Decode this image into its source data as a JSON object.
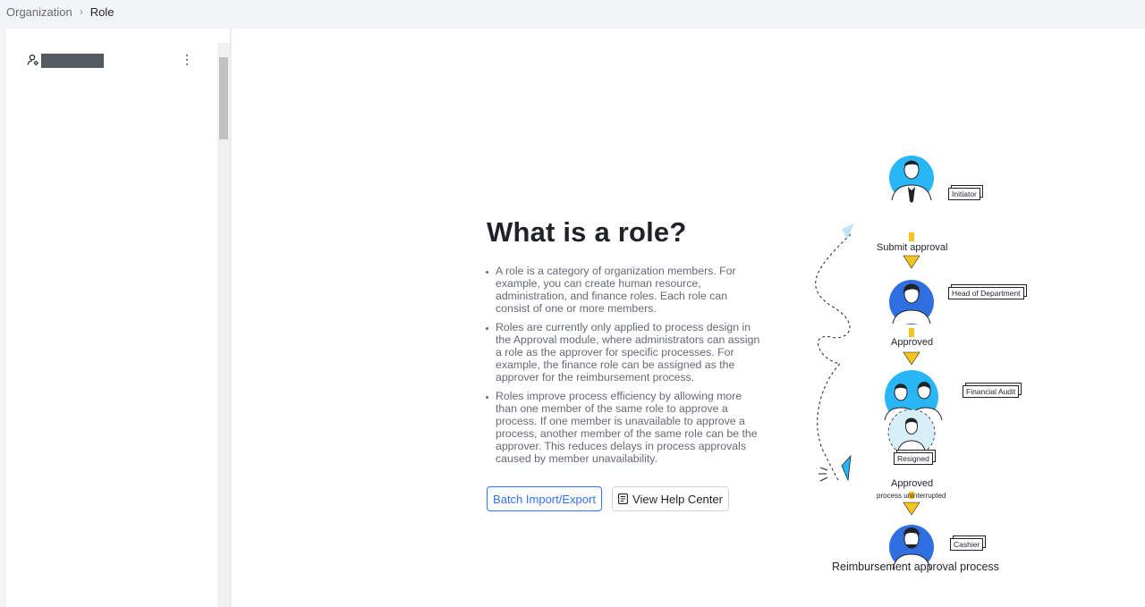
{
  "breadcrumb": {
    "root": "Organization",
    "current": "Role"
  },
  "sidebar": {
    "role_icon": "role-user-icon",
    "more_icon": "more-vertical-icon"
  },
  "intro": {
    "title": "What is a role?",
    "bullets": [
      "A role is a category of organization members. For example, you can create human resource, administration, and finance roles. Each role can consist of one or more members.",
      "Roles are currently only applied to process design in the Approval module, where administrators can assign a role as the approver for specific processes. For example, the finance role can be assigned as the approver for the reimbursement process.",
      "Roles improve process efficiency by allowing more than one member of the same role to approve a process. If one member is unavailable to approve a process, another member of the same role can be the approver. This reduces delays in process approvals caused by member unavailability."
    ],
    "batch_button": "Batch Import/Export",
    "help_button": "View Help Center"
  },
  "illustration": {
    "tags": {
      "initiator": "Initiator",
      "head": "Head of Department",
      "finance": "Financial Audit",
      "resigned": "Resigned",
      "cashier": "Cashier"
    },
    "steps": {
      "submit": "Submit approval",
      "approved1": "Approved",
      "approved2": "Approved",
      "uninterrupted": "process uninterrupted"
    },
    "caption": "Reimbursement approval process"
  },
  "colors": {
    "accent": "#3370ff",
    "sky": "#29b6f6",
    "blue": "#2f6fe0",
    "arrow": "#f7c41f"
  }
}
